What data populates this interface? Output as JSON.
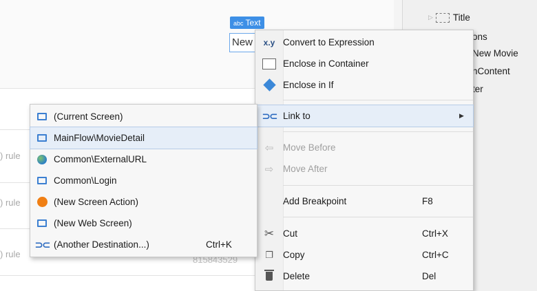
{
  "canvas": {
    "badge_abc": "abc",
    "badge_label": "Text",
    "new_text": "New",
    "row_labels": [
      ") rule",
      ") rule",
      ") rule"
    ],
    "faded_number": "815843529"
  },
  "tree": {
    "title": "Title",
    "partial_items": [
      "ons",
      "New Movie",
      "nContent",
      "ter"
    ]
  },
  "main_menu": {
    "items": [
      {
        "icon": "xy-icon",
        "label": "Convert to Expression",
        "shortcut": ""
      },
      {
        "icon": "container-icon",
        "label": "Enclose in Container",
        "shortcut": ""
      },
      {
        "icon": "if-diamond-icon",
        "label": "Enclose in If",
        "shortcut": ""
      },
      {
        "icon": "link-icon",
        "label": "Link to",
        "shortcut": ""
      },
      {
        "icon": "move-before-icon",
        "label": "Move Before",
        "shortcut": ""
      },
      {
        "icon": "move-after-icon",
        "label": "Move After",
        "shortcut": ""
      },
      {
        "icon": "",
        "label": "Add Breakpoint",
        "shortcut": "F8"
      },
      {
        "icon": "scissors-icon",
        "label": "Cut",
        "shortcut": "Ctrl+X"
      },
      {
        "icon": "copy-icon",
        "label": "Copy",
        "shortcut": "Ctrl+C"
      },
      {
        "icon": "trash-icon",
        "label": "Delete",
        "shortcut": "Del"
      }
    ]
  },
  "sub_menu": {
    "items": [
      {
        "icon": "screen-icon",
        "label": "(Current Screen)",
        "shortcut": ""
      },
      {
        "icon": "screen-icon",
        "label": "MainFlow\\MovieDetail",
        "shortcut": ""
      },
      {
        "icon": "globe-icon",
        "label": "Common\\ExternalURL",
        "shortcut": ""
      },
      {
        "icon": "screen-icon",
        "label": "Common\\Login",
        "shortcut": ""
      },
      {
        "icon": "action-circle-icon",
        "label": "(New Screen Action)",
        "shortcut": ""
      },
      {
        "icon": "screen-icon",
        "label": "(New Web Screen)",
        "shortcut": ""
      },
      {
        "icon": "link-icon",
        "label": "(Another Destination...)",
        "shortcut": "Ctrl+K"
      }
    ]
  }
}
